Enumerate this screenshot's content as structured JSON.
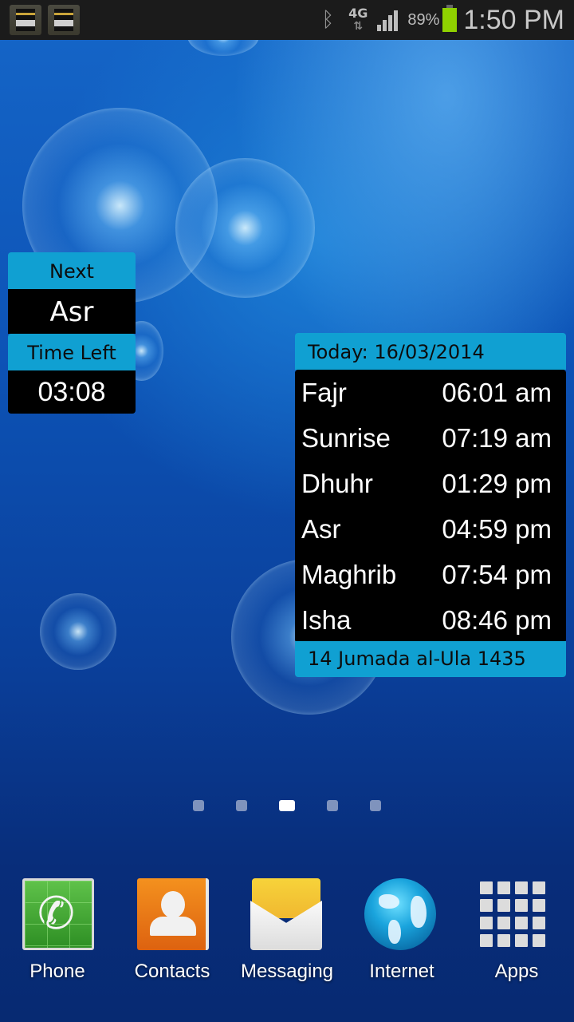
{
  "status_bar": {
    "notifications": [
      {
        "icon": "kaaba-icon"
      },
      {
        "icon": "kaaba-icon"
      }
    ],
    "bluetooth_icon": "bluetooth-icon",
    "network_type": "4G",
    "network_arrows": "⇅",
    "battery_percent": "89%",
    "battery_level": 0.89,
    "time": "1:50 PM"
  },
  "next_prayer_widget": {
    "next_label": "Next",
    "next_prayer": "Asr",
    "time_left_label": "Time Left",
    "time_left": "03:08"
  },
  "prayer_times_widget": {
    "date_label": "Today: 16/03/2014",
    "prayers": [
      {
        "name": "Fajr",
        "time": "06:01 am"
      },
      {
        "name": "Sunrise",
        "time": "07:19 am"
      },
      {
        "name": "Dhuhr",
        "time": "01:29 pm"
      },
      {
        "name": "Asr",
        "time": "04:59 pm"
      },
      {
        "name": "Maghrib",
        "time": "07:54 pm"
      },
      {
        "name": "Isha",
        "time": "08:46 pm"
      }
    ],
    "hijri_date": "14 Jumada al-Ula 1435"
  },
  "page_indicator": {
    "count": 5,
    "active_index": 2
  },
  "dock": [
    {
      "label": "Phone",
      "icon": "phone-icon"
    },
    {
      "label": "Contacts",
      "icon": "contacts-icon"
    },
    {
      "label": "Messaging",
      "icon": "messaging-icon"
    },
    {
      "label": "Internet",
      "icon": "internet-globe-icon"
    },
    {
      "label": "Apps",
      "icon": "apps-grid-icon"
    }
  ],
  "colors": {
    "widget_accent": "#10a0d2",
    "widget_body": "#000000",
    "battery": "#8fd100"
  }
}
